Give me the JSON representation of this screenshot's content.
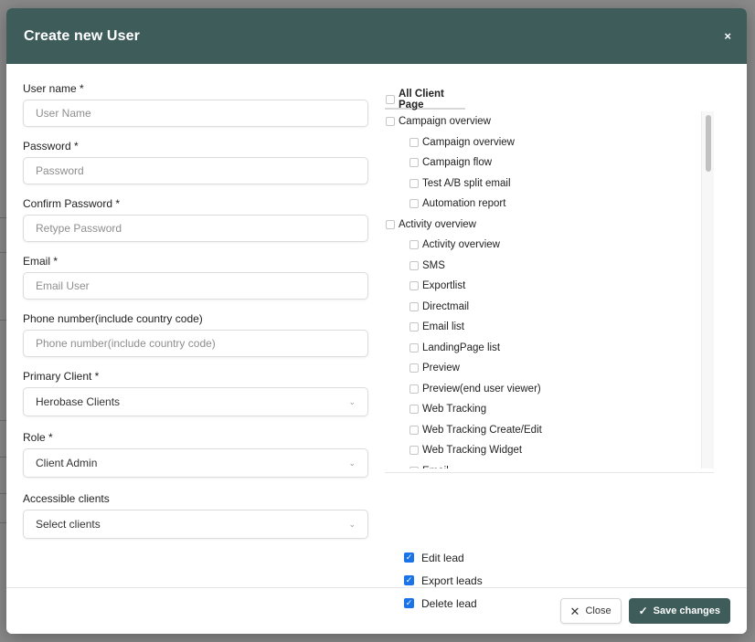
{
  "modal": {
    "title": "Create new User",
    "close_symbol": "×"
  },
  "form": {
    "username": {
      "label": "User name *",
      "placeholder": "User Name",
      "value": ""
    },
    "password": {
      "label": "Password *",
      "placeholder": "Password",
      "value": ""
    },
    "confirm_password": {
      "label": "Confirm Password *",
      "placeholder": "Retype Password",
      "value": ""
    },
    "email": {
      "label": "Email *",
      "placeholder": "Email User",
      "value": ""
    },
    "phone": {
      "label": "Phone number(include country code)",
      "placeholder": "Phone number(include country code)",
      "value": ""
    },
    "primary_client": {
      "label": "Primary Client *",
      "selected": "Herobase Clients"
    },
    "role": {
      "label": "Role *",
      "selected": "Client Admin"
    },
    "accessible_clients": {
      "label": "Accessible clients",
      "selected": "Select clients"
    }
  },
  "permissions": {
    "header": "All Client Page",
    "items": [
      {
        "label": "Campaign overview",
        "level": "group",
        "checked": false
      },
      {
        "label": "Campaign overview",
        "level": "sub",
        "checked": false
      },
      {
        "label": "Campaign flow",
        "level": "sub",
        "checked": false
      },
      {
        "label": "Test A/B split email",
        "level": "sub",
        "checked": false
      },
      {
        "label": "Automation report",
        "level": "sub",
        "checked": false
      },
      {
        "label": "Activity overview",
        "level": "group",
        "checked": false
      },
      {
        "label": "Activity overview",
        "level": "sub",
        "checked": false
      },
      {
        "label": "SMS",
        "level": "sub",
        "checked": false
      },
      {
        "label": "Exportlist",
        "level": "sub",
        "checked": false
      },
      {
        "label": "Directmail",
        "level": "sub",
        "checked": false
      },
      {
        "label": "Email list",
        "level": "sub",
        "checked": false
      },
      {
        "label": "LandingPage list",
        "level": "sub",
        "checked": false
      },
      {
        "label": "Preview",
        "level": "sub",
        "checked": false
      },
      {
        "label": "Preview(end user viewer)",
        "level": "sub",
        "checked": false
      },
      {
        "label": "Web Tracking",
        "level": "sub",
        "checked": false
      },
      {
        "label": "Web Tracking Create/Edit",
        "level": "sub",
        "checked": false
      },
      {
        "label": "Web Tracking Widget",
        "level": "sub",
        "checked": false
      },
      {
        "label": "Email",
        "level": "sub",
        "checked": false
      }
    ]
  },
  "lead_permissions": [
    {
      "label": "Edit lead",
      "checked": true
    },
    {
      "label": "Export leads",
      "checked": true
    },
    {
      "label": "Delete lead",
      "checked": true
    }
  ],
  "footer": {
    "close_label": "Close",
    "save_label": "Save changes"
  },
  "colors": {
    "header_bg": "#3d5c5a",
    "save_bg": "#3d5c5a",
    "checkbox_checked": "#1a73e8"
  },
  "icons": {
    "close": "close-icon",
    "save": "check-icon",
    "dropdown": "chevron-down-icon"
  }
}
